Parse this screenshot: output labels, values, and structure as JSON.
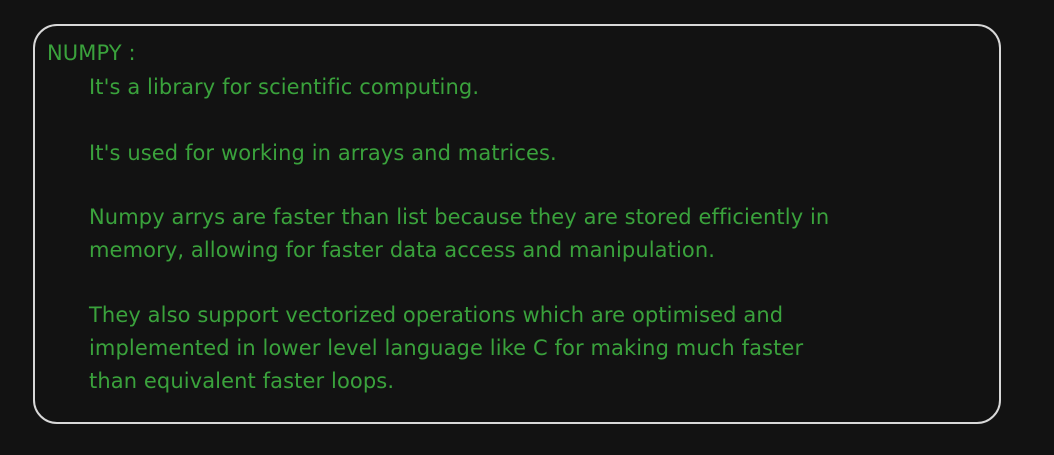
{
  "note": {
    "heading": "NUMPY :",
    "lines": [
      "It's a library for scientific computing.",
      "It's used for working in arrays and matrices.",
      "Numpy arrys are faster than list because they are stored efficiently in\nmemory, allowing for faster data access and manipulation.",
      "They also support vectorized operations which are optimised and\nimplemented in lower level language like C for making much faster\nthan equivalent faster loops."
    ]
  },
  "colors": {
    "background": "#121212",
    "text": "#3aa23c",
    "border": "#d8d8d8"
  }
}
